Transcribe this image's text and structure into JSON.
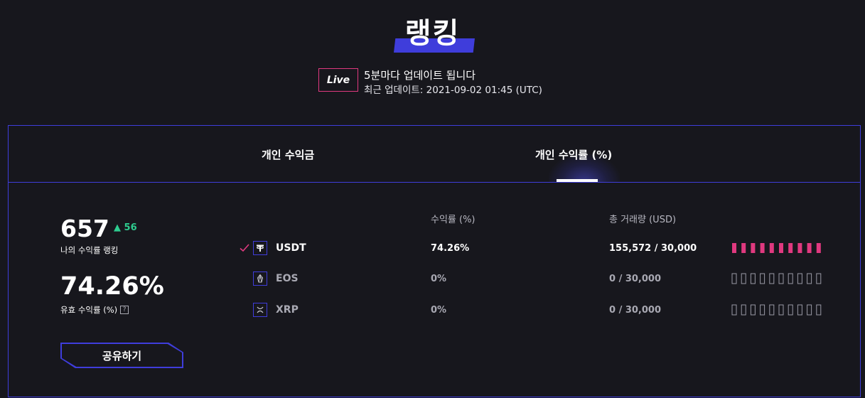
{
  "header": {
    "title": "랭킹",
    "live_badge": "Live",
    "update_interval": "5분마다 업데이트 됩니다",
    "last_update": "최근 업데이트: 2021-09-02 01:45 (UTC)"
  },
  "tabs": [
    {
      "label": "개인 수익금",
      "active": false
    },
    {
      "label": "개인 수익률 (%)",
      "active": true
    }
  ],
  "stats": {
    "rank": "657",
    "rank_change": "▲ 56",
    "rank_label": "나의 수익률 랭킹",
    "roi": "74.26%",
    "roi_label": "유효 수익률 (%)",
    "roi_help": "?"
  },
  "share_button": "공유하기",
  "table": {
    "columns": {
      "roi": "수익률 (%)",
      "volume": "총 거래량 (USD)"
    },
    "rows": [
      {
        "coin": "USDT",
        "icon": "tether-icon",
        "selected": true,
        "roi": "74.26%",
        "volume": "155,572 / 30,000",
        "progress_filled": 10,
        "progress_total": 10
      },
      {
        "coin": "EOS",
        "icon": "eos-icon",
        "selected": false,
        "roi": "0%",
        "volume": "0 / 30,000",
        "progress_filled": 0,
        "progress_total": 10
      },
      {
        "coin": "XRP",
        "icon": "xrp-icon",
        "selected": false,
        "roi": "0%",
        "volume": "0 / 30,000",
        "progress_filled": 0,
        "progress_total": 10
      }
    ]
  },
  "colors": {
    "accent": "#3f3ddb",
    "pink": "#e0397f",
    "green": "#2ecc8f",
    "background": "#17171d"
  }
}
